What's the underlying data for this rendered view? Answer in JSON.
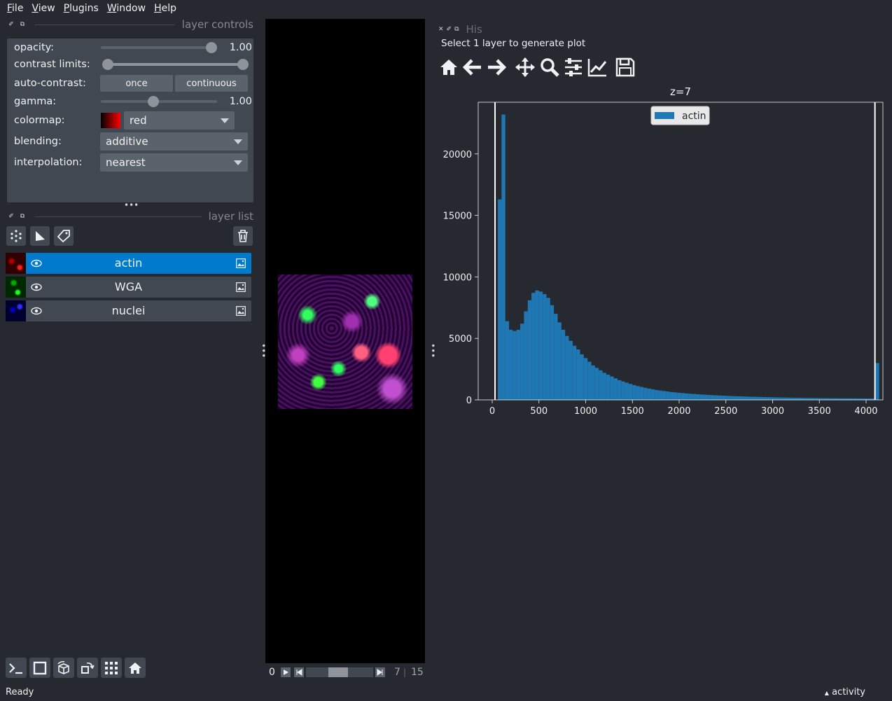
{
  "menu": {
    "items": [
      {
        "first": "F",
        "rest": "ile"
      },
      {
        "first": "V",
        "rest": "iew"
      },
      {
        "first": "P",
        "rest": "lugins"
      },
      {
        "first": "W",
        "rest": "indow"
      },
      {
        "first": "H",
        "rest": "elp"
      }
    ]
  },
  "layer_controls": {
    "title": "layer controls",
    "opacity_label": "opacity:",
    "opacity_value": "1.00",
    "opacity_fraction": 1.0,
    "contrast_label": "contrast limits:",
    "autocontrast_label": "auto-contrast:",
    "once_label": "once",
    "continuous_label": "continuous",
    "gamma_label": "gamma:",
    "gamma_value": "1.00",
    "colormap_label": "colormap:",
    "colormap_value": "red",
    "blending_label": "blending:",
    "blending_value": "additive",
    "interpolation_label": "interpolation:",
    "interpolation_value": "nearest"
  },
  "layer_list": {
    "title": "layer list",
    "layers": [
      {
        "name": "actin",
        "color": "#ff2020",
        "selected": true
      },
      {
        "name": "WGA",
        "color": "#20ff20",
        "selected": false
      },
      {
        "name": "nuclei",
        "color": "#3030ff",
        "selected": false
      }
    ]
  },
  "dims": {
    "start": "0",
    "current": "7",
    "separator": "|",
    "total": "15",
    "position_fraction": 0.47
  },
  "histogram": {
    "tab_title": "His",
    "message": "Select 1 layer to generate plot",
    "toolbar_icons": [
      "home-icon",
      "back-arrow-icon",
      "forward-arrow-icon",
      "pan-icon",
      "zoom-icon",
      "configure-subplots-icon",
      "edit-axis-icon",
      "save-icon"
    ]
  },
  "chart_data": {
    "type": "bar",
    "title": "z=7",
    "xlabel": "",
    "ylabel": "",
    "xlim": [
      -150,
      4180
    ],
    "ylim": [
      0,
      24200
    ],
    "xticks": [
      0,
      500,
      1000,
      1500,
      2000,
      2500,
      3000,
      3500,
      4000
    ],
    "yticks": [
      0,
      5000,
      10000,
      15000,
      20000
    ],
    "bin_width": 40,
    "vlines": [
      30,
      4095
    ],
    "legend": {
      "entries": [
        "actin"
      ],
      "placement": "top-center"
    },
    "series": [
      {
        "name": "actin",
        "color": "#1f77b4",
        "bin_starts": [
          60,
          100,
          140,
          180,
          220,
          260,
          300,
          340,
          380,
          420,
          460,
          500,
          540,
          580,
          620,
          660,
          700,
          740,
          780,
          820,
          860,
          900,
          940,
          980,
          1020,
          1060,
          1100,
          1140,
          1180,
          1220,
          1260,
          1300,
          1340,
          1380,
          1420,
          1460,
          1500,
          1540,
          1580,
          1620,
          1660,
          1700,
          1740,
          1780,
          1820,
          1860,
          1900,
          1940,
          1980,
          2020,
          2060,
          2100,
          2140,
          2180,
          2220,
          2260,
          2300,
          2340,
          2380,
          2420,
          2460,
          2500,
          2540,
          2580,
          2620,
          2660,
          2700,
          2740,
          2780,
          2820,
          2860,
          2900,
          2940,
          2980,
          3020,
          3060,
          3100,
          3140,
          3180,
          3220,
          3260,
          3300,
          3340,
          3380,
          3420,
          3460,
          3500,
          3540,
          3580,
          3620,
          3660,
          3700,
          3740,
          3780,
          3820,
          3860,
          3900,
          3940,
          3980,
          4020,
          4060,
          4100
        ],
        "values": [
          16300,
          23200,
          6400,
          5700,
          5600,
          5700,
          6200,
          7200,
          8100,
          8700,
          8900,
          8800,
          8600,
          8300,
          7700,
          7000,
          6300,
          5700,
          5200,
          4800,
          4400,
          4100,
          3700,
          3400,
          3100,
          2800,
          2600,
          2400,
          2200,
          2050,
          1900,
          1750,
          1600,
          1500,
          1400,
          1300,
          1200,
          1120,
          1050,
          980,
          920,
          860,
          800,
          760,
          720,
          680,
          640,
          610,
          580,
          550,
          520,
          500,
          480,
          460,
          440,
          420,
          400,
          385,
          370,
          355,
          340,
          325,
          310,
          300,
          290,
          280,
          270,
          260,
          250,
          240,
          232,
          225,
          218,
          210,
          204,
          198,
          192,
          186,
          180,
          175,
          170,
          165,
          160,
          156,
          152,
          148,
          144,
          140,
          137,
          134,
          131,
          128,
          126,
          124,
          122,
          120,
          118,
          116,
          114,
          112,
          110,
          3000
        ]
      }
    ]
  },
  "bottom_toolbar": {
    "icons": [
      "console-icon",
      "2d-3d-toggle-icon",
      "roll-dims-icon",
      "transpose-icon",
      "grid-icon",
      "home-icon"
    ]
  },
  "status": {
    "text": "Ready",
    "activity": "activity"
  }
}
